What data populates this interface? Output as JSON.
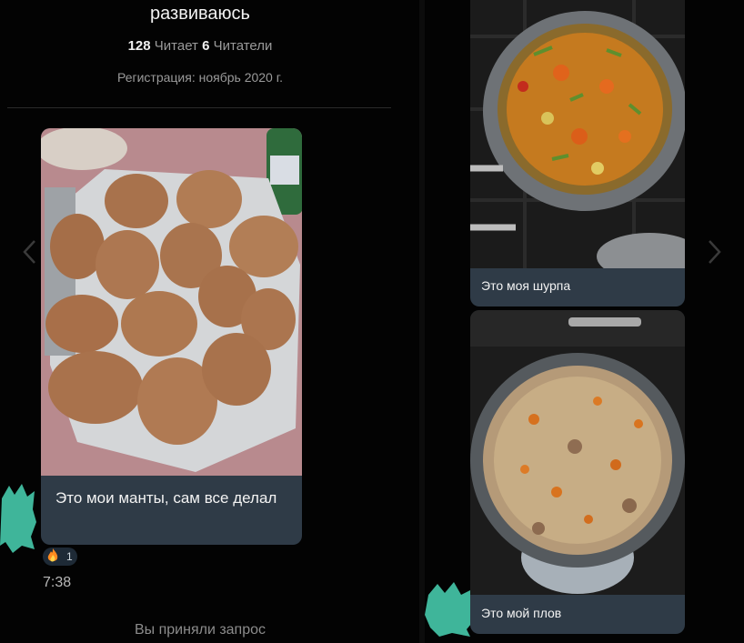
{
  "profile": {
    "name_partial": "развиваюсь",
    "following_count": "128",
    "following_label": "Читает",
    "followers_count": "6",
    "followers_label": "Читатели",
    "registration": "Регистрация: ноябрь 2020 г."
  },
  "messages": [
    {
      "caption": "Это мои манты, сам все делал",
      "photo_icon": "manti-photo"
    },
    {
      "caption": "Это моя шурпа",
      "photo_icon": "shurpa-photo"
    },
    {
      "caption": "Это мой плов",
      "photo_icon": "plov-photo"
    }
  ],
  "reaction": {
    "emoji": "fire-icon",
    "count": "1"
  },
  "time": "7:38",
  "system_message": "Вы приняли запрос",
  "colors": {
    "bubble": "#2f3b47",
    "background": "#000000",
    "avatar_blur": "#3fb59a"
  }
}
